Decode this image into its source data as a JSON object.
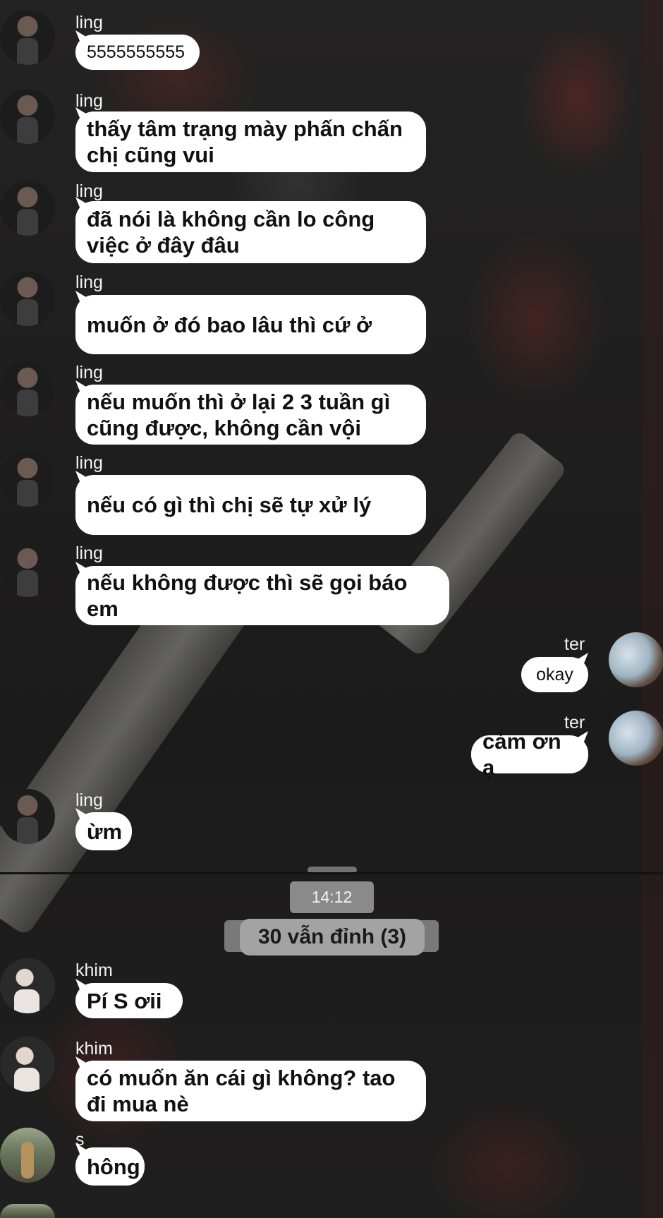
{
  "messages": [
    {
      "sender": "ling",
      "text": "5555555555"
    },
    {
      "sender": "ling",
      "text": "thấy tâm trạng mày phấn chấn chị cũng vui"
    },
    {
      "sender": "ling",
      "text": "đã nói là không cần lo công việc ở đây đâu"
    },
    {
      "sender": "ling",
      "text": "muốn ở đó bao lâu thì cứ ở"
    },
    {
      "sender": "ling",
      "text": "nếu muốn thì ở lại 2 3 tuần gì cũng được, không cần vội"
    },
    {
      "sender": "ling",
      "text": "nếu có gì thì chị sẽ tự xử lý"
    },
    {
      "sender": "ling",
      "text": "nếu không được thì sẽ gọi báo em"
    },
    {
      "sender": "ter",
      "text": "okay"
    },
    {
      "sender": "ter",
      "text": "cảm ơn ạ"
    },
    {
      "sender": "ling",
      "text": "ừm"
    },
    {
      "sender": "khim",
      "text": "Pí  S ơii"
    },
    {
      "sender": "khim",
      "text": "có muốn ăn cái gì không? tao đi mua nè"
    },
    {
      "sender": "s",
      "text": "hông"
    }
  ],
  "separator": {
    "time": "14:12",
    "group_name": "30 vẫn đỉnh (3)"
  },
  "colors": {
    "bubble": "#ffffff",
    "name_text": "#f2f2f2",
    "pill": "#8a8a8a"
  }
}
